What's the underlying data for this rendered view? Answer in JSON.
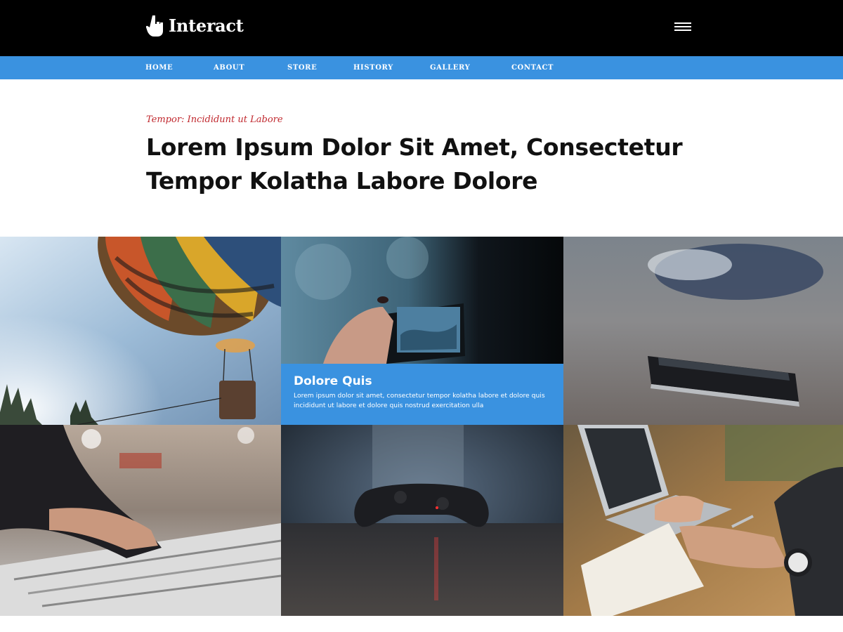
{
  "header": {
    "logo_text": "Interact",
    "logo_icon": "pointing-hand-icon",
    "menu_icon": "hamburger-menu-icon"
  },
  "nav": {
    "items": [
      {
        "label": "HOME"
      },
      {
        "label": "ABOUT"
      },
      {
        "label": "STORE"
      },
      {
        "label": "HISTORY"
      },
      {
        "label": "GALLERY"
      },
      {
        "label": "CONTACT"
      }
    ]
  },
  "hero": {
    "kicker": "Tempor: Incididunt ut Labore",
    "headline": "Lorem Ipsum Dolor Sit Amet, Consectetur Tempor Kolatha Labore Dolore"
  },
  "gallery": {
    "tiles": [
      {
        "subject": "hot-air-balloon-photo"
      },
      {
        "subject": "hand-holding-smartphone-photo"
      },
      {
        "subject": "smartphone-on-table-photo"
      },
      {
        "subject": "mixing-console-photo"
      },
      {
        "subject": "game-controller-photo"
      },
      {
        "subject": "writing-in-notebook-photo"
      }
    ],
    "caption": {
      "title": "Dolore Quis",
      "text": "Lorem ipsum dolor sit amet, consectetur tempor kolatha labore et dolore quis incididunt ut labore et dolore quis nostrud exercitation ulla"
    }
  },
  "colors": {
    "topbar": "#000000",
    "accent": "#3a92e0",
    "kicker": "#c0272d",
    "headline": "#111111"
  }
}
